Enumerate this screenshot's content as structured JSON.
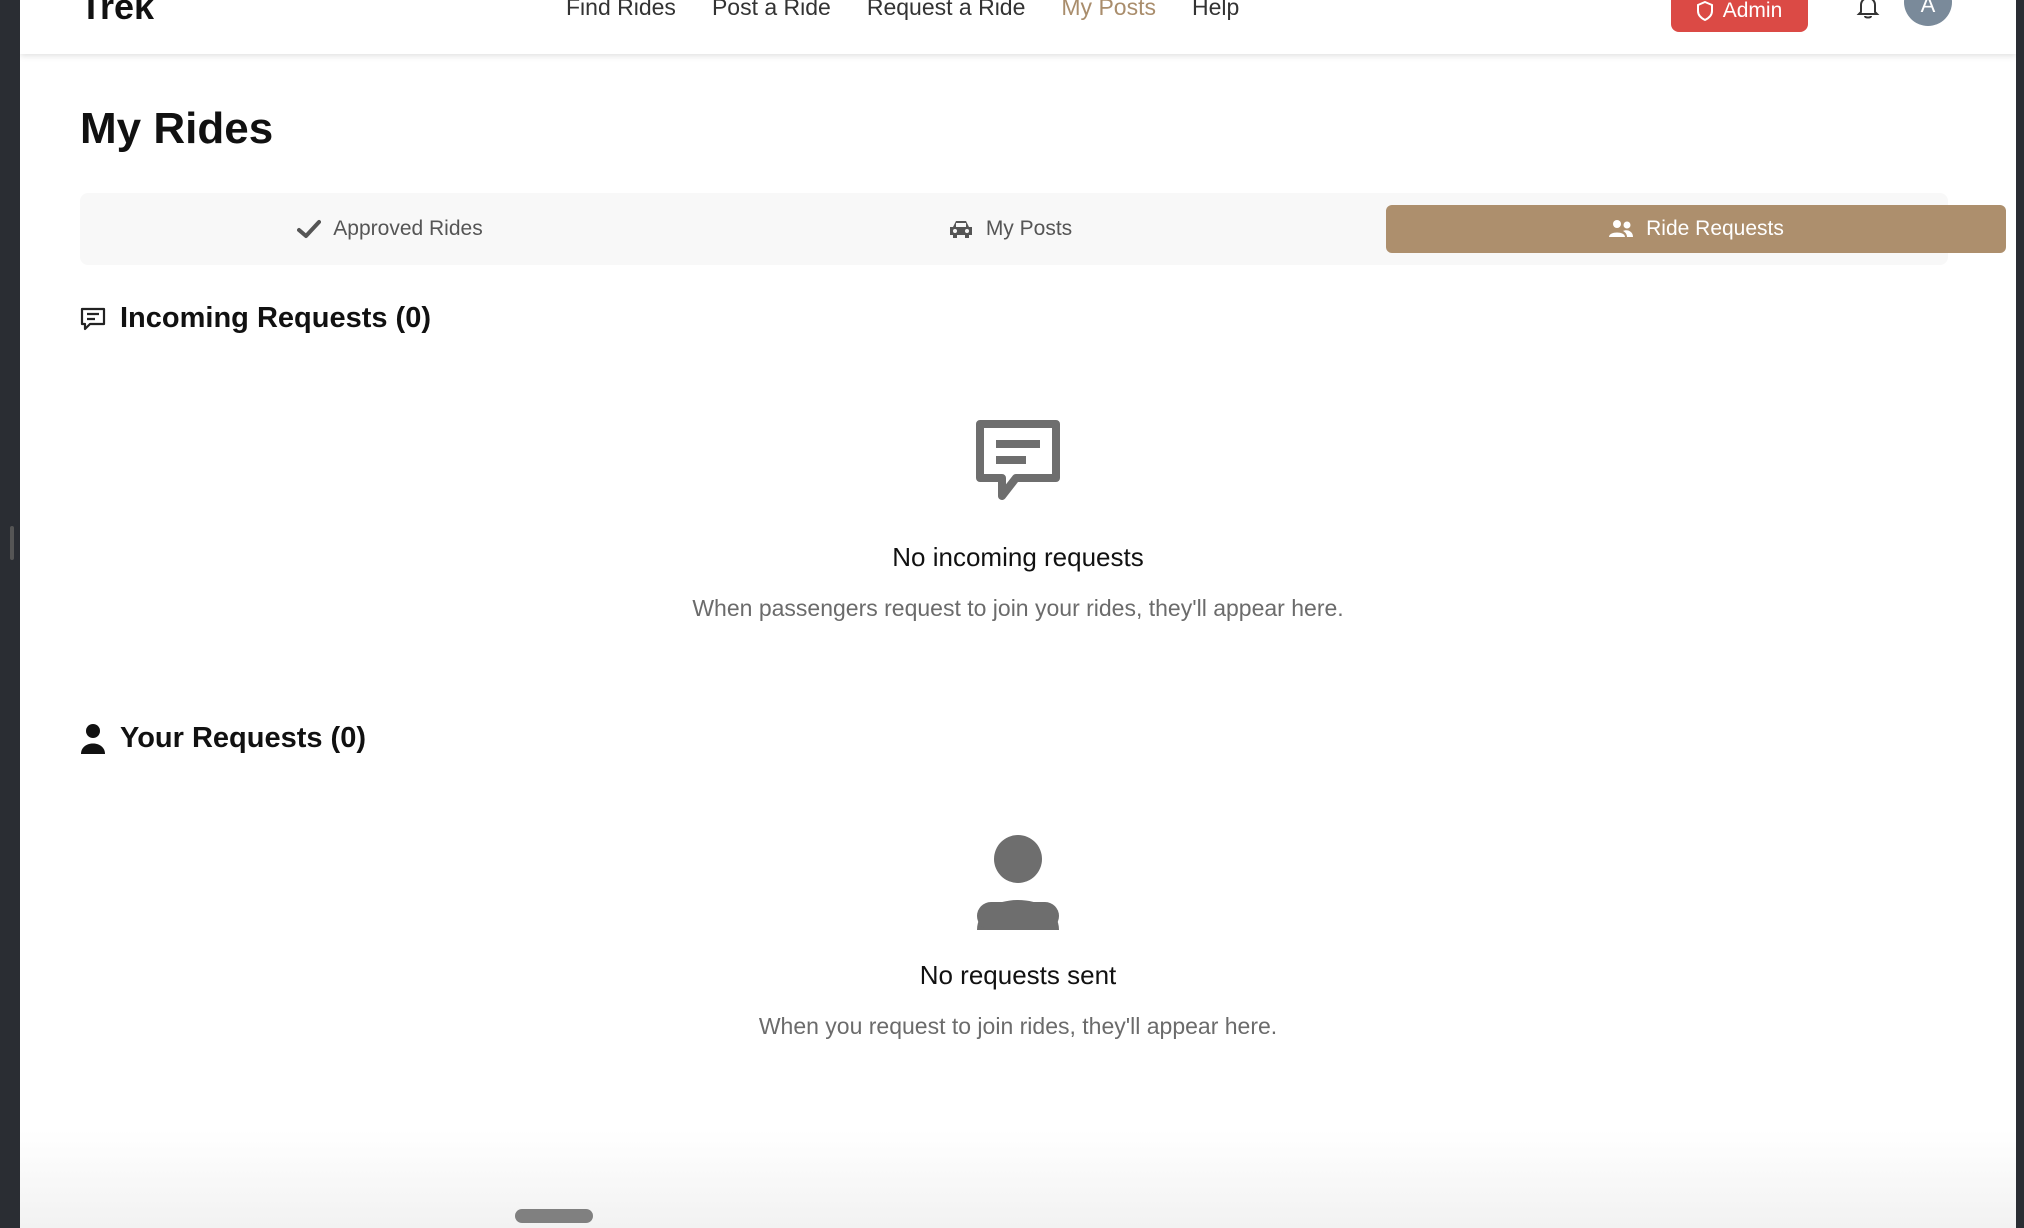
{
  "header": {
    "brand": "Trek",
    "nav": [
      "Find Rides",
      "Post a Ride",
      "Request a Ride",
      "My Posts",
      "Help"
    ],
    "active_nav": "My Posts",
    "admin_label": "Admin",
    "avatar_initial": "A"
  },
  "page": {
    "title": "My Rides"
  },
  "tabs": [
    {
      "label": "Approved Rides",
      "icon": "check-icon"
    },
    {
      "label": "My Posts",
      "icon": "car-icon"
    },
    {
      "label": "Ride Requests",
      "icon": "users-icon",
      "selected": true
    }
  ],
  "incoming": {
    "heading": "Incoming Requests (0)",
    "empty_title": "No incoming requests",
    "empty_desc": "When passengers request to join your rides, they'll appear here."
  },
  "yours": {
    "heading": "Your Requests (0)",
    "empty_title": "No requests sent",
    "empty_desc": "When you request to join rides, they'll appear here."
  },
  "colors": {
    "accent": "#ad8f6d",
    "admin": "#db4a45",
    "active_nav": "#a98d6c"
  }
}
